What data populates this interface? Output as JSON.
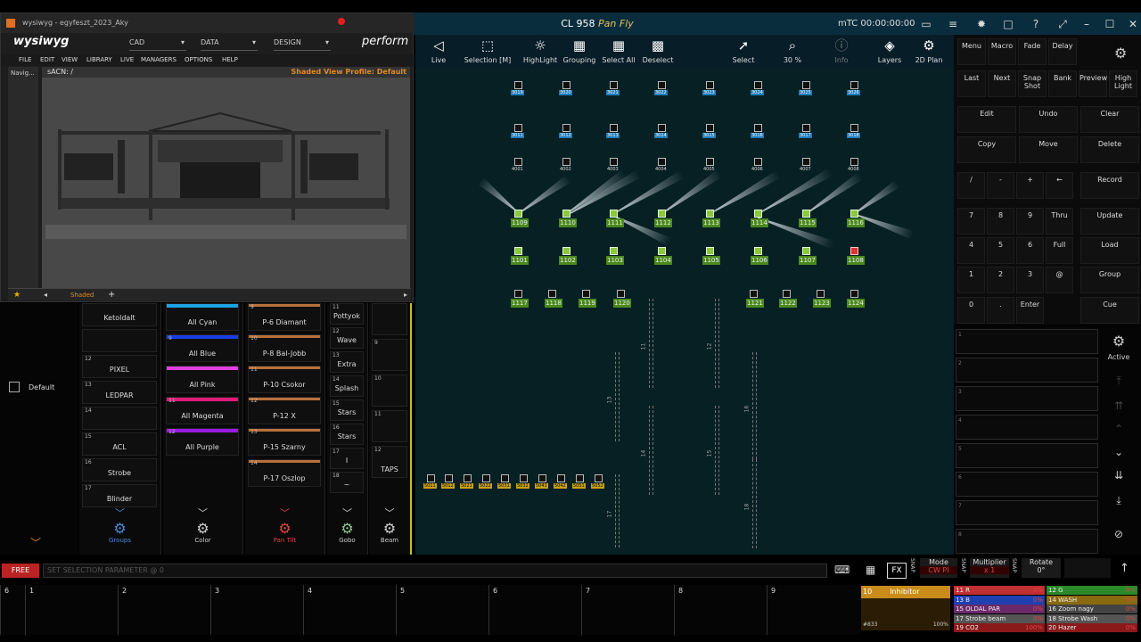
{
  "titlebar": {
    "title": "CL 958",
    "preview_name": "Pan Fly",
    "mtc": "mTC 00:00:00:00"
  },
  "toolbar": [
    {
      "label": "Live",
      "icon": "live-icon"
    },
    {
      "label": "Selection [M]",
      "icon": "selection-icon"
    },
    {
      "label": "HighLight",
      "icon": "bulb-icon"
    },
    {
      "label": "Grouping",
      "icon": "grouping-icon"
    },
    {
      "label": "Select All",
      "icon": "select-all-icon"
    },
    {
      "label": "Deselect",
      "icon": "deselect-icon"
    },
    {
      "label": "Select",
      "icon": "cursor-icon"
    },
    {
      "label": "30 %",
      "icon": "zoom-icon"
    },
    {
      "label": "Info",
      "icon": "info-icon"
    },
    {
      "label": "Layers",
      "icon": "layers-icon"
    },
    {
      "label": "2D Plan",
      "icon": "gear-icon"
    }
  ],
  "wysiwyg": {
    "window_title": "wysiwyg - egyfeszt_2023_Aky",
    "logo": "wysiwyg",
    "dropdowns": [
      "CAD",
      "DATA",
      "DESIGN"
    ],
    "mode": "perform",
    "menu": [
      "FILE",
      "EDIT",
      "VIEW",
      "LIBRARY",
      "LIVE",
      "MANAGERS",
      "OPTIONS",
      "HELP"
    ],
    "nav": "Navig...",
    "view_title": "sACN: /",
    "profile": "Shaded View Profile: Default",
    "tab": "Shaded"
  },
  "left": {
    "default_label": "Default"
  },
  "columns": [
    {
      "name": "Groups",
      "items": [
        {
          "n": "",
          "t": "Ketoldalt"
        },
        {
          "n": "",
          "t": ""
        },
        {
          "n": "12",
          "t": "PIXEL"
        },
        {
          "n": "13",
          "t": "LEDPAR"
        },
        {
          "n": "14",
          "t": ""
        },
        {
          "n": "15",
          "t": "ACL"
        },
        {
          "n": "16",
          "t": "Strobe"
        },
        {
          "n": "17",
          "t": "Blinder"
        }
      ]
    },
    {
      "name": "Color",
      "items": [
        {
          "n": "",
          "t": "All Cyan",
          "c": "#1da1e0"
        },
        {
          "n": "9",
          "t": "All Blue",
          "c": "#1a3ee0"
        },
        {
          "n": "",
          "t": "All Pink",
          "c": "#e040e0"
        },
        {
          "n": "11",
          "t": "All Magenta",
          "c": "#e01a7a"
        },
        {
          "n": "12",
          "t": "All Purple",
          "c": "#9a1ae0"
        }
      ]
    },
    {
      "name": "Pan Tilt",
      "items": [
        {
          "n": "9",
          "t": "P-6 Diamant"
        },
        {
          "n": "10",
          "t": "P-8 Bal-Jobb"
        },
        {
          "n": "11",
          "t": "P-10 Csokor"
        },
        {
          "n": "12",
          "t": "P-12 X"
        },
        {
          "n": "13",
          "t": "P-15 Szarny"
        },
        {
          "n": "14",
          "t": "P-17 Oszlop"
        }
      ]
    },
    {
      "name": "Gobo",
      "items": [
        {
          "n": "11",
          "t": "Pottyok"
        },
        {
          "n": "12",
          "t": "Wave"
        },
        {
          "n": "13",
          "t": "Extra"
        },
        {
          "n": "14",
          "t": "Splash"
        },
        {
          "n": "15",
          "t": "Stars"
        },
        {
          "n": "16",
          "t": "Stars"
        },
        {
          "n": "17",
          "t": "I"
        },
        {
          "n": "18",
          "t": "~"
        }
      ]
    },
    {
      "name": "Beam",
      "items": [
        {
          "n": "",
          "t": ""
        },
        {
          "n": "9",
          "t": ""
        },
        {
          "n": "10",
          "t": ""
        },
        {
          "n": "11",
          "t": ""
        },
        {
          "n": "12",
          "t": "TAPS"
        }
      ]
    }
  ],
  "programmer": {
    "keys": [
      "Menu",
      "Macro",
      "Fade",
      "Delay",
      "Last",
      "Next",
      "Snap Shot",
      "Bank",
      "Preview",
      "High Light",
      "Edit",
      "Undo",
      "Clear",
      "Copy",
      "Move",
      "Delete",
      "/",
      "-",
      "+",
      "←",
      "Record",
      "7",
      "8",
      "9",
      "Thru",
      "Update",
      "4",
      "5",
      "6",
      "Full",
      "Load",
      "1",
      "2",
      "3",
      "@",
      "Group",
      "0",
      ".",
      "Enter",
      "Cue"
    ],
    "active": "Active"
  },
  "command": {
    "state": "FREE",
    "placeholder": "SET SELECTION PARAMETER @ 0"
  },
  "fx": {
    "label": "FX",
    "mode": "Mode",
    "mode_value": "CW PI",
    "multiplier": "Multiplier",
    "mult_value": "x 1",
    "rotate": "Rotate",
    "rotate_value": "0°",
    "snap": "SNAP"
  },
  "executors": [
    "6",
    "1",
    "2",
    "3",
    "4",
    "5",
    "6",
    "7",
    "8",
    "9"
  ],
  "inhibitor": {
    "num": "10",
    "label": "Inhibitor",
    "value": "#833",
    "pct": "100%"
  },
  "group_rows": [
    {
      "l": "11 R",
      "p": "0%",
      "c": "#c03030"
    },
    {
      "l": "12 G",
      "p": "0%",
      "c": "#2a8a2a"
    },
    {
      "l": "13 B",
      "p": "0%",
      "c": "#2040b0"
    },
    {
      "l": "14 WASH",
      "p": "0%",
      "c": "#8a6a10"
    },
    {
      "l": "15 OLDAL PAR",
      "p": "0%",
      "c": "#6a2a6a"
    },
    {
      "l": "16 Zoom nagy",
      "p": "0%",
      "c": "#444"
    },
    {
      "l": "17 Strobe beam",
      "p": "0%",
      "c": "#555"
    },
    {
      "l": "18 Strobe Wash",
      "p": "0%",
      "c": "#555"
    },
    {
      "l": "19 CO2",
      "p": "100%",
      "c": "#8a1a1a"
    },
    {
      "l": "20 Hazer",
      "p": "0%",
      "c": "#8a1a1a"
    }
  ],
  "fixtures": {
    "row1": [
      "3019",
      "3020",
      "3021",
      "3022",
      "3023",
      "3024",
      "3025",
      "3026"
    ],
    "row2": [
      "3011",
      "3012",
      "3013",
      "3014",
      "3015",
      "3016",
      "3017",
      "3018"
    ],
    "row3": [
      "4001",
      "4002",
      "4003",
      "4004",
      "4005",
      "4006",
      "4007",
      "4008"
    ],
    "row4": [
      "1109",
      "1110",
      "1111",
      "1112",
      "1113",
      "1114",
      "1115",
      "1116"
    ],
    "row5": [
      "1101",
      "1102",
      "1103",
      "1104",
      "1105",
      "1106",
      "1107",
      "1108"
    ],
    "row6a": [
      "1117",
      "1118",
      "1119",
      "1120"
    ],
    "row6b": [
      "1121",
      "1122",
      "1123",
      "1124"
    ],
    "bottom": [
      "5011",
      "5012",
      "5021",
      "5022",
      "5031",
      "5032",
      "5041",
      "5042",
      "5051",
      "5052"
    ],
    "truss": [
      "11",
      "12",
      "13",
      "14",
      "15",
      "16",
      "17",
      "18"
    ]
  }
}
